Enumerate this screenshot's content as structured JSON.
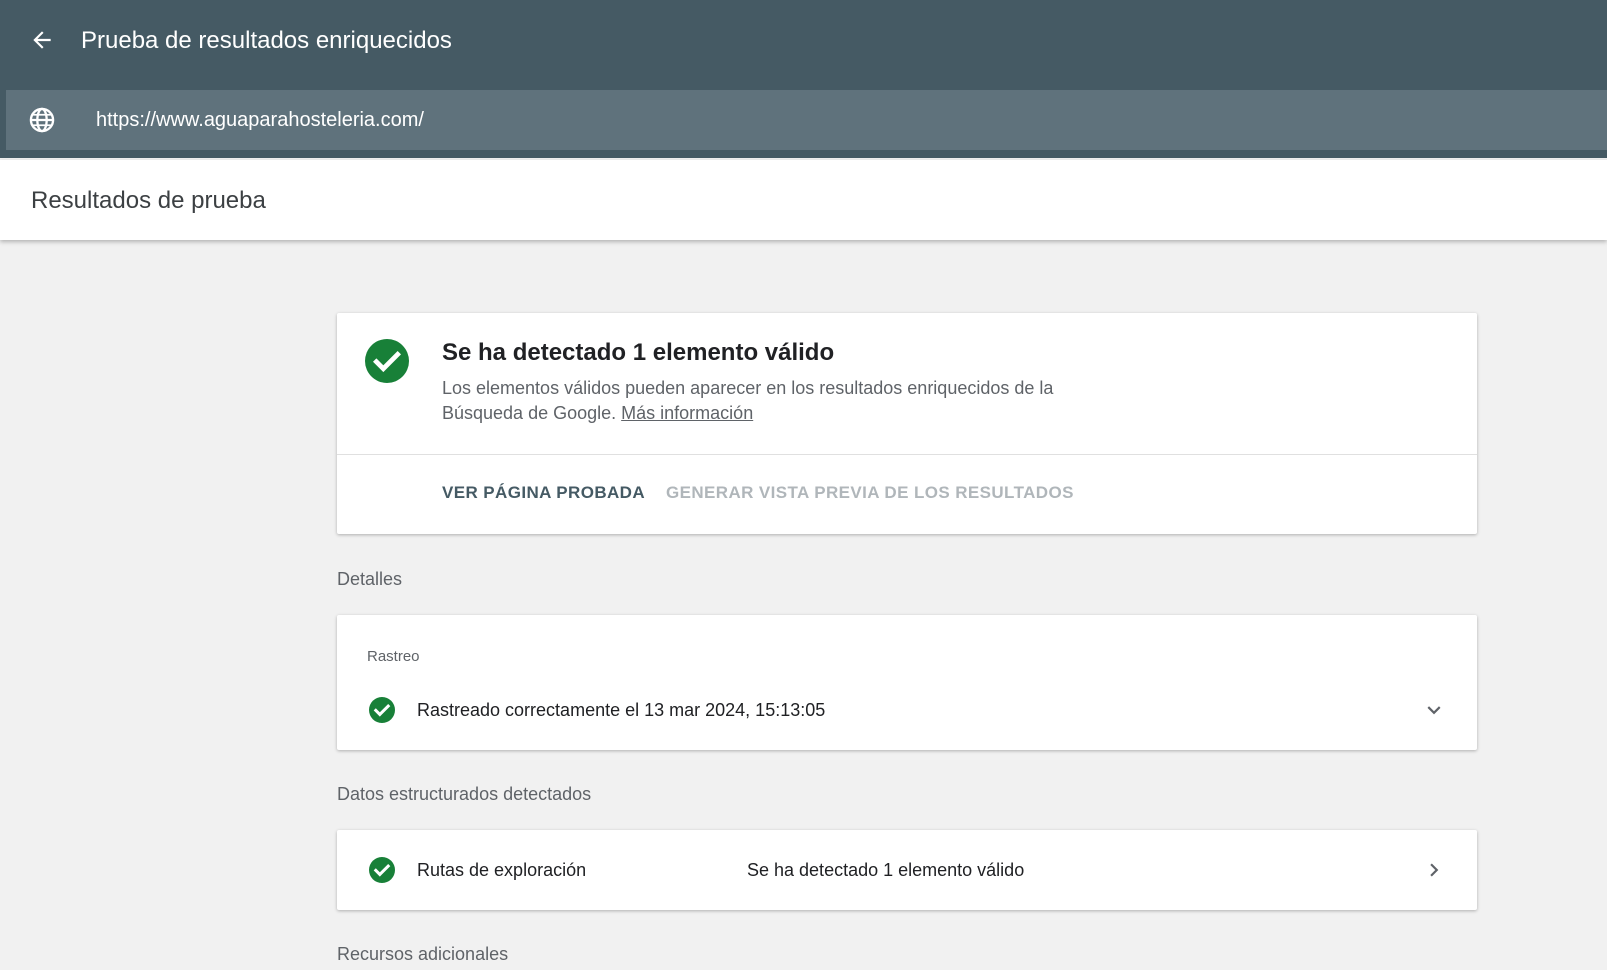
{
  "header": {
    "title": "Prueba de resultados enriquecidos",
    "url": "https://www.aguaparahosteleria.com/"
  },
  "subheader": {
    "title": "Resultados de prueba"
  },
  "summary": {
    "headline": "Se ha detectado 1 elemento válido",
    "description": "Los elementos válidos pueden aparecer en los resultados enriquecidos de la Búsqueda de Google.",
    "link": "Más información",
    "view_button": "VER PÁGINA PROBADA",
    "preview_button": "GENERAR VISTA PREVIA DE LOS RESULTADOS"
  },
  "details": {
    "label": "Detalles",
    "crawl": {
      "label": "Rastreo",
      "status": "Rastreado correctamente el 13 mar 2024, 15:13:05"
    }
  },
  "structured": {
    "label": "Datos estructurados detectados",
    "items": [
      {
        "name": "Rutas de exploración",
        "status": "Se ha detectado 1 elemento válido"
      }
    ]
  },
  "resources": {
    "label": "Recursos adicionales"
  },
  "icons": {
    "back": "arrow-back-icon",
    "globe": "globe-icon",
    "check": "check-circle-icon",
    "expand": "chevron-down-icon",
    "next": "chevron-right-icon"
  },
  "colors": {
    "appbar": "#455a64",
    "urlbar": "#5f727c",
    "success": "#188038",
    "background": "#f1f1f1"
  }
}
